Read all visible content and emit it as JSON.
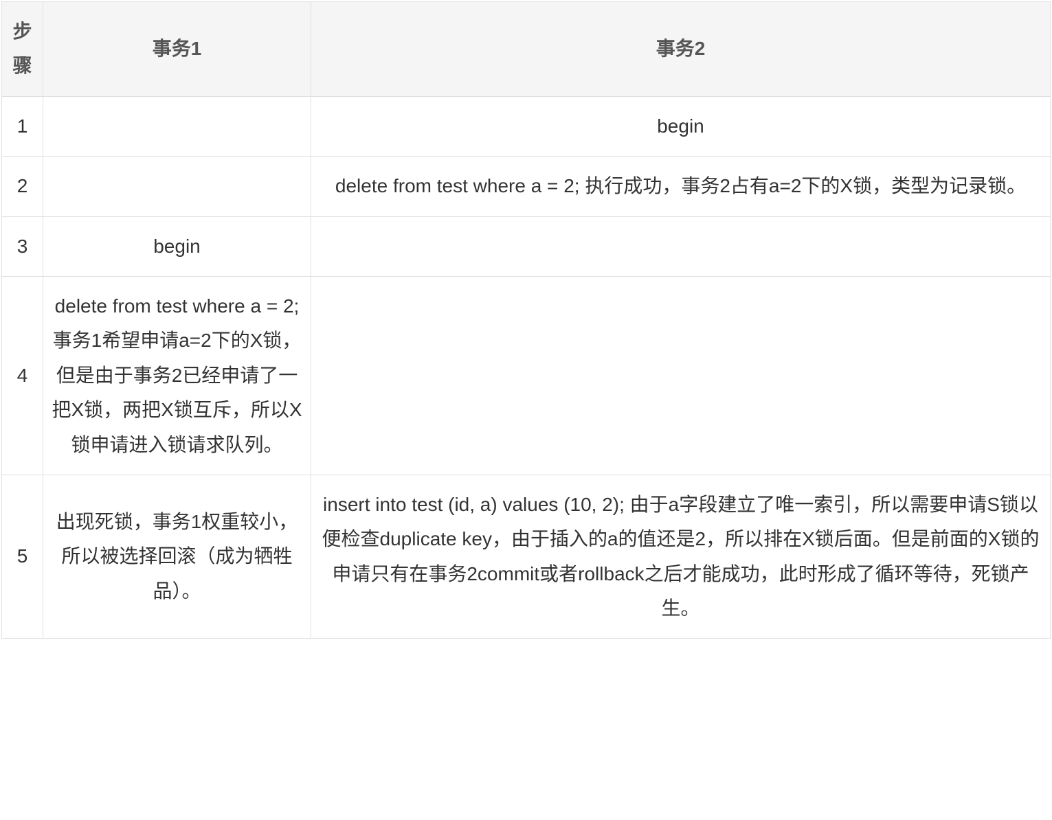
{
  "table": {
    "headers": {
      "step": "步骤",
      "tx1": "事务1",
      "tx2": "事务2"
    },
    "rows": [
      {
        "step": "1",
        "tx1": "",
        "tx2": "begin"
      },
      {
        "step": "2",
        "tx1": "",
        "tx2": "delete from test where a = 2; 执行成功，事务2占有a=2下的X锁，类型为记录锁。"
      },
      {
        "step": "3",
        "tx1": "begin",
        "tx2": ""
      },
      {
        "step": "4",
        "tx1": "delete from test where a = 2; 事务1希望申请a=2下的X锁，但是由于事务2已经申请了一把X锁，两把X锁互斥，所以X锁申请进入锁请求队列。",
        "tx2": ""
      },
      {
        "step": "5",
        "tx1": "出现死锁，事务1权重较小，所以被选择回滚（成为牺牲品）。",
        "tx2": "insert into test (id, a) values (10, 2); 由于a字段建立了唯一索引，所以需要申请S锁以便检查duplicate key，由于插入的a的值还是2，所以排在X锁后面。但是前面的X锁的申请只有在事务2commit或者rollback之后才能成功，此时形成了循环等待，死锁产生。"
      }
    ]
  }
}
